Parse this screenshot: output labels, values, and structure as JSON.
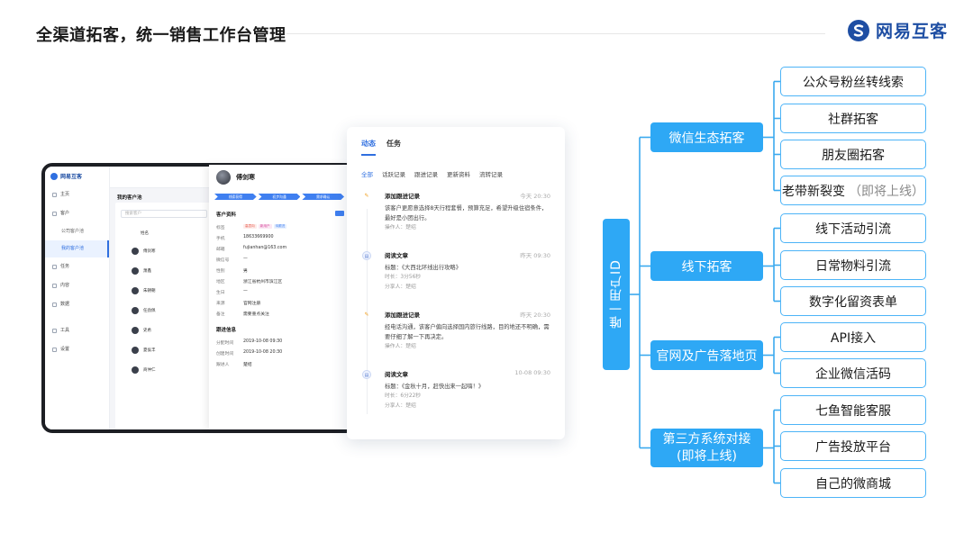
{
  "header": {
    "title": "全渠道拓客，统一销售工作台管理",
    "brand_name": "网易互客"
  },
  "laptop": {
    "app_name": "网易互客",
    "sidebar": [
      {
        "label": "主页"
      },
      {
        "label": "客户"
      },
      {
        "label": "公司客户池",
        "sub": true
      },
      {
        "label": "我的客户池",
        "sub": true,
        "active": true
      },
      {
        "label": "任务"
      },
      {
        "label": "内容"
      },
      {
        "label": "数据"
      },
      {
        "label": "工具"
      },
      {
        "label": "设置"
      }
    ],
    "list_title": "我的客户池",
    "search_placeholder": "搜索客户",
    "list_head": "姓名",
    "list_rows": [
      "傅剑寒",
      "萧鑫",
      "朱朝朝",
      "任劲佩",
      "史希",
      "夏侯丰",
      "商仲仁"
    ]
  },
  "detail": {
    "name": "傅剑寒",
    "stages": [
      "线索获得",
      "初步沟通",
      "需求确认"
    ],
    "section_profile": "客户资料",
    "fields": [
      {
        "k": "标签",
        "v": ""
      },
      {
        "k": "手机",
        "v": "18633669900"
      },
      {
        "k": "邮箱",
        "v": "fujianhan@163.com"
      },
      {
        "k": "微信号",
        "v": "—"
      },
      {
        "k": "性别",
        "v": "男"
      },
      {
        "k": "地区",
        "v": "浙江省杭州市滨江区"
      },
      {
        "k": "生日",
        "v": "—"
      },
      {
        "k": "来源",
        "v": "官网注册"
      },
      {
        "k": "备注",
        "v": "需要重点关注"
      }
    ],
    "tags": [
      {
        "text": "高意向",
        "color": "#e8564a",
        "bg": "#fdecea"
      },
      {
        "text": "新用户",
        "color": "#d6479b",
        "bg": "#fbe7f3"
      },
      {
        "text": "待跟进",
        "color": "#3f7ff0",
        "bg": "#e8f0fe"
      }
    ],
    "section_follow": "跟进信息",
    "follow_fields": [
      {
        "k": "分配时间",
        "v": "2019-10-08 09:30"
      },
      {
        "k": "创建时间",
        "v": "2019-10-08 20:30"
      },
      {
        "k": "跟进人",
        "v": "楚绍"
      }
    ]
  },
  "activity": {
    "tabs": [
      "动态",
      "任务"
    ],
    "filters": [
      "全部",
      "话跃记录",
      "跟进记录",
      "更新资料",
      "流转记录"
    ],
    "items": [
      {
        "icon": "pencil-icon",
        "title": "添加跟进记录",
        "time": "今天 20:30",
        "body": "该客户更愿意选择8天行程套餐，预算充足，希望升级住宿条件，最好是小团出行。",
        "meta1": "操作人：楚绍",
        "meta2": ""
      },
      {
        "icon": "doc-icon",
        "title": "阅读文章",
        "time": "昨天 09:30",
        "body": "标题：《大西北环线出行攻略》",
        "meta1": "时长：3分56秒",
        "meta2": "分享人：楚绍"
      },
      {
        "icon": "pencil-icon",
        "title": "添加跟进记录",
        "time": "昨天 20:30",
        "body": "经电话沟通，该客户偏向选择国内旅行线路，目的地还不明确，需要仔细了解一下再决定。",
        "meta1": "操作人：楚绍",
        "meta2": ""
      },
      {
        "icon": "doc-icon",
        "title": "阅读文章",
        "time": "10-08 09:30",
        "body": "标题：《金秋十月，赶快出来一起嗨！》",
        "meta1": "时长：6分22秒",
        "meta2": "分享人：楚绍"
      }
    ]
  },
  "mindmap": {
    "root": "唯一用户ID",
    "channels": [
      {
        "label": "微信生态拓客",
        "leaves": [
          {
            "text": "公众号粉丝转线索"
          },
          {
            "text": "社群拓客"
          },
          {
            "text": "朋友圈拓客"
          },
          {
            "text": "老带新裂变",
            "note": "（即将上线）"
          }
        ]
      },
      {
        "label": "线下拓客",
        "leaves": [
          {
            "text": "线下活动引流"
          },
          {
            "text": "日常物料引流"
          },
          {
            "text": "数字化留资表单"
          }
        ]
      },
      {
        "label": "官网及广告落地页",
        "leaves": [
          {
            "text": "API接入"
          },
          {
            "text": "企业微信活码"
          }
        ]
      },
      {
        "label_line1": "第三方系统对接",
        "label_line2": "(即将上线)",
        "leaves": [
          {
            "text": "七鱼智能客服"
          },
          {
            "text": "广告投放平台"
          },
          {
            "text": "自己的微商城"
          }
        ]
      }
    ],
    "colors": {
      "node": "#2ea8f5",
      "leaf_border": "#4db4f7",
      "line": "#3aa9ef"
    }
  }
}
